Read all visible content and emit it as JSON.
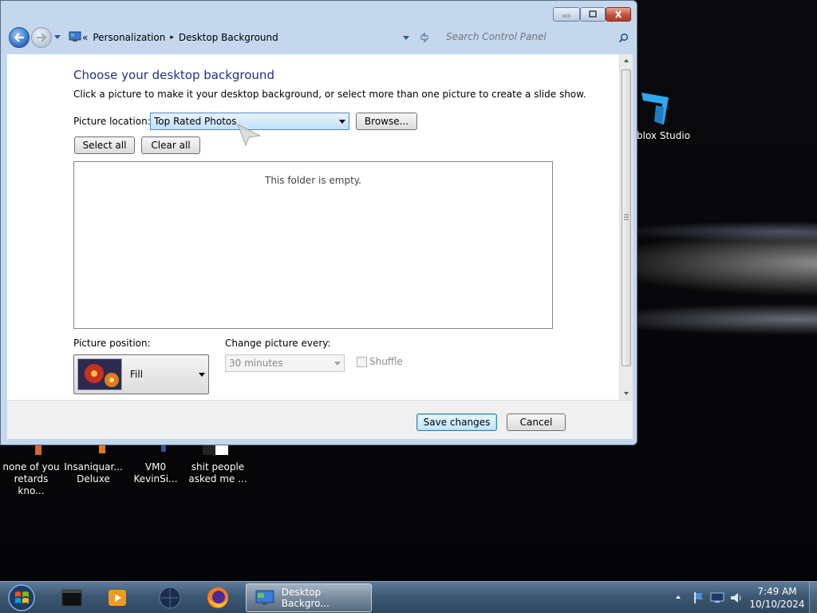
{
  "desktop": {
    "icons": [
      {
        "name": "none-of-you",
        "label_line1": "none of you",
        "label_line2": "retards kno..."
      },
      {
        "name": "insaniquarium",
        "label_line1": "Insaniquar...",
        "label_line2": "Deluxe"
      },
      {
        "name": "vm0",
        "label_line1": "VM0",
        "label_line2": "KevinSi..."
      },
      {
        "name": "shit-people",
        "label_line1": "shit people",
        "label_line2": "asked me ..."
      }
    ],
    "roblox_label": "blox Studio"
  },
  "window": {
    "breadcrumb": {
      "chevron": "«",
      "items": [
        "Personalization",
        "Desktop Background"
      ],
      "separator": "▸"
    },
    "search_placeholder": "Search Control Panel",
    "heading": "Choose your desktop background",
    "instructions": "Click a picture to make it your desktop background, or select more than one picture to create a slide show.",
    "picture_location_label": "Picture location:",
    "picture_location_value": "Top Rated Photos",
    "browse_button": "Browse...",
    "select_all_button": "Select all",
    "clear_all_button": "Clear all",
    "empty_message": "This folder is empty.",
    "picture_position_label": "Picture position:",
    "picture_position_value": "Fill",
    "change_picture_label": "Change picture every:",
    "change_picture_value": "30 minutes",
    "shuffle_label": "Shuffle",
    "save_button": "Save changes",
    "cancel_button": "Cancel"
  },
  "taskbar": {
    "active_task_label": "Desktop Backgro...",
    "clock_time": "7:49 AM",
    "clock_date": "10/10/2024"
  },
  "colors": {
    "heading": "#1e3287",
    "window_frame": "#c4d7ed",
    "taskbar": "#3d5873"
  }
}
